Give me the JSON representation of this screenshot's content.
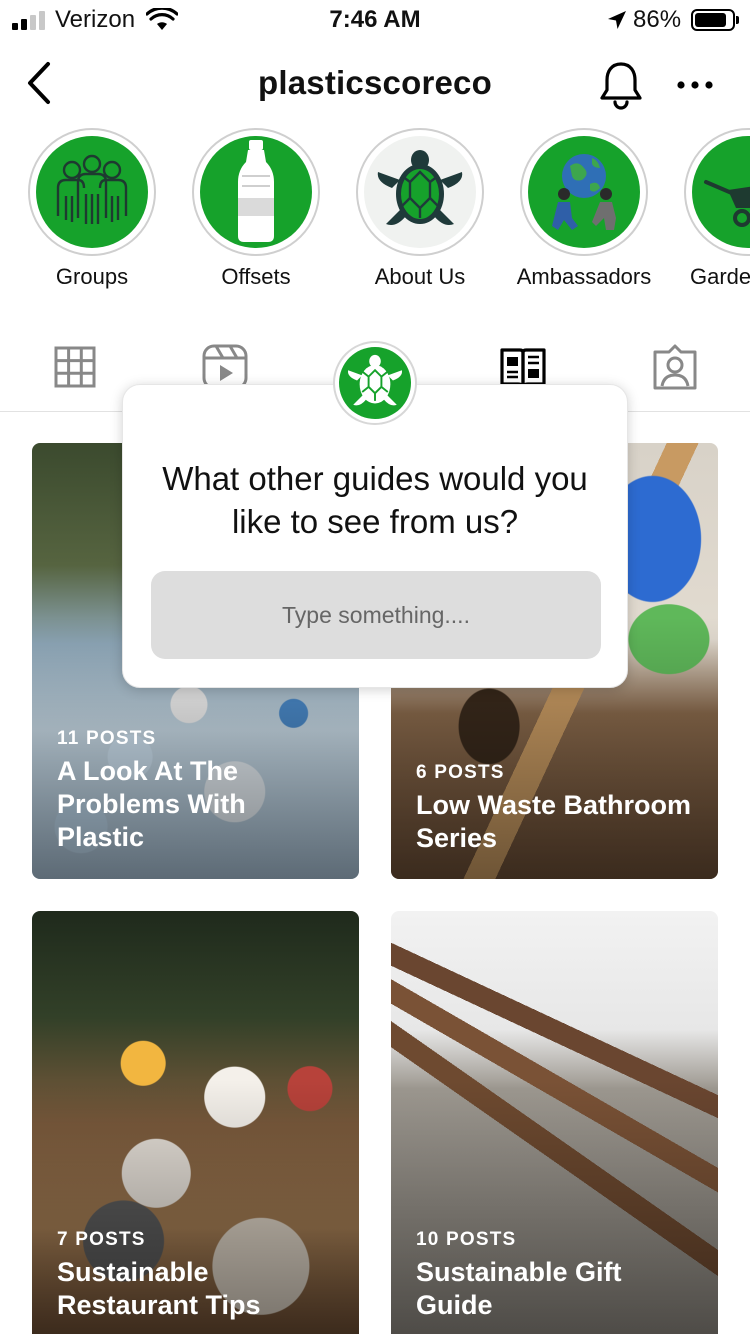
{
  "status_bar": {
    "carrier": "Verizon",
    "time": "7:46 AM",
    "battery_percent": "86%",
    "battery_level": 0.86,
    "signal_bars": 2,
    "icons": [
      "signal-icon",
      "wifi-icon",
      "location-arrow-icon",
      "battery-icon"
    ]
  },
  "header": {
    "profile_name": "plasticscoreco",
    "icons": [
      "back-chevron-icon",
      "bell-icon",
      "more-dots-icon"
    ]
  },
  "highlights": [
    {
      "label": "Groups",
      "icon": "people-icon"
    },
    {
      "label": "Offsets",
      "icon": "bottle-icon"
    },
    {
      "label": "About Us",
      "icon": "turtle-icon"
    },
    {
      "label": "Ambassadors",
      "icon": "globe-people-icon"
    },
    {
      "label": "Garde",
      "icon": "wheelbarrow-icon"
    }
  ],
  "tabs": [
    {
      "name": "grid-tab",
      "icon": "grid-icon"
    },
    {
      "name": "reels-tab",
      "icon": "reels-icon"
    },
    {
      "name": "shop-tab",
      "icon": "turtle-icon"
    },
    {
      "name": "guides-tab",
      "icon": "guide-book-icon"
    },
    {
      "name": "tagged-tab",
      "icon": "tagged-person-icon"
    }
  ],
  "guides": [
    {
      "count": "11 POSTS",
      "title": "A Look At The Problems With Plastic"
    },
    {
      "count": "6 POSTS",
      "title": "Low Waste Bathroom Series"
    },
    {
      "count": "7 POSTS",
      "title": "Sustainable Restaurant Tips"
    },
    {
      "count": "10 POSTS",
      "title": "Sustainable Gift Guide"
    }
  ],
  "popup": {
    "question": "What other guides would you like to see from us?",
    "placeholder": "Type something...."
  },
  "colors": {
    "brand_green": "#16a22b",
    "turtle_dark": "#1f3a3a"
  }
}
